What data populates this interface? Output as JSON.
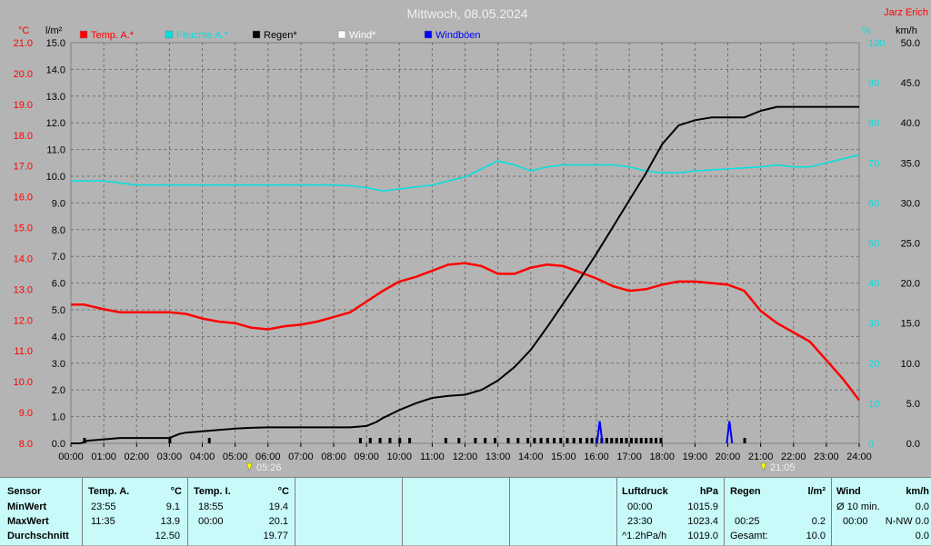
{
  "title": "Mittwoch, 08.05.2024",
  "author": "Jarz Erich",
  "axis_units": {
    "temp": "°C",
    "rain": "l/m²",
    "humidity": "%",
    "wind": "km/h"
  },
  "colors": {
    "temp": "#ff0000",
    "humidity": "#00e0e0",
    "rain": "#000000",
    "wind": "#ffffff",
    "gust": "#0000ff",
    "bg": "#b4b4b4",
    "grid": "#707070",
    "panel": "#c8fafa"
  },
  "legend": [
    {
      "label": "Temp. A.*",
      "color": "#ff0000"
    },
    {
      "label": "Feuchte A.*",
      "color": "#00e0e0"
    },
    {
      "label": "Regen*",
      "color": "#000000"
    },
    {
      "label": "Wind*",
      "color": "#ffffff"
    },
    {
      "label": "Windböen",
      "color": "#0000ff"
    }
  ],
  "sun": {
    "sunrise": "05:26",
    "sunset": "21:05"
  },
  "chart_data": {
    "type": "line",
    "x_ticks": [
      "00:00",
      "01:00",
      "02:00",
      "03:00",
      "04:00",
      "05:00",
      "06:00",
      "07:00",
      "08:00",
      "09:00",
      "10:00",
      "11:00",
      "12:00",
      "13:00",
      "14:00",
      "15:00",
      "16:00",
      "17:00",
      "18:00",
      "19:00",
      "20:00",
      "21:00",
      "22:00",
      "23:00",
      "24:00"
    ],
    "temp_ticks": [
      "21.0",
      "20.0",
      "19.0",
      "18.0",
      "17.0",
      "16.0",
      "15.0",
      "14.0",
      "13.0",
      "12.0",
      "11.0",
      "10.0",
      "9.0",
      "8.0"
    ],
    "rain_ticks": [
      "15.0",
      "14.0",
      "13.0",
      "12.0",
      "11.0",
      "10.0",
      "9.0",
      "8.0",
      "7.0",
      "6.0",
      "5.0",
      "4.0",
      "3.0",
      "2.0",
      "1.0",
      "0.0"
    ],
    "hum_ticks": [
      "100",
      "90",
      "80",
      "70",
      "60",
      "50",
      "40",
      "30",
      "20",
      "10",
      "0"
    ],
    "wind_ticks": [
      "50.0",
      "45.0",
      "40.0",
      "35.0",
      "30.0",
      "25.0",
      "20.0",
      "15.0",
      "10.0",
      "5.0",
      "0.0"
    ],
    "temp_range": [
      8,
      21
    ],
    "rain_range": [
      0,
      15
    ],
    "hum_range": [
      0,
      100
    ],
    "wind_range": [
      0,
      50
    ],
    "series": [
      {
        "name": "Temp. A.*",
        "axis": "temp",
        "x": [
          0,
          0.4,
          1,
          1.5,
          2,
          2.5,
          3,
          3.5,
          4,
          4.5,
          5,
          5.5,
          6,
          6.5,
          7,
          7.5,
          8,
          8.5,
          9,
          9.5,
          10,
          10.5,
          11,
          11.5,
          12,
          12.5,
          13,
          13.5,
          14,
          14.5,
          15,
          15.5,
          16,
          16.5,
          17,
          17.5,
          18,
          18.5,
          19,
          19.5,
          20,
          20.5,
          21,
          21.5,
          22,
          22.5,
          23,
          23.5,
          24
        ],
        "y": [
          12.5,
          12.5,
          12.35,
          12.25,
          12.25,
          12.25,
          12.25,
          12.2,
          12.05,
          11.95,
          11.9,
          11.75,
          11.7,
          11.8,
          11.85,
          11.95,
          12.1,
          12.25,
          12.6,
          12.95,
          13.25,
          13.4,
          13.6,
          13.8,
          13.85,
          13.75,
          13.5,
          13.5,
          13.7,
          13.8,
          13.75,
          13.55,
          13.35,
          13.1,
          12.95,
          13.0,
          13.15,
          13.25,
          13.25,
          13.2,
          13.15,
          12.95,
          12.3,
          11.9,
          11.6,
          11.3,
          10.7,
          10.1,
          9.4
        ]
      },
      {
        "name": "Feuchte A.*",
        "axis": "humidity",
        "x": [
          0,
          1,
          1.5,
          2,
          3,
          4,
          5,
          6,
          7,
          8,
          8.5,
          9,
          9.5,
          10,
          11,
          12,
          12.5,
          13,
          13.5,
          14,
          14.5,
          15,
          16,
          16.5,
          17,
          17.5,
          18,
          18.5,
          19,
          20,
          21,
          21.5,
          22,
          22.5,
          23,
          23.5,
          24
        ],
        "y": [
          65.5,
          65.5,
          65,
          64.5,
          64.5,
          64.5,
          64.5,
          64.5,
          64.5,
          64.5,
          64.3,
          63.8,
          63,
          63.5,
          64.5,
          66.5,
          68.5,
          70.5,
          69.5,
          68,
          69,
          69.5,
          69.5,
          69.5,
          69,
          68,
          67.5,
          67.5,
          68,
          68.5,
          69,
          69.5,
          69,
          69,
          70,
          71,
          72
        ]
      },
      {
        "name": "Regen*",
        "axis": "rain",
        "x": [
          0,
          0.3,
          0.5,
          1,
          1.5,
          2,
          2.5,
          3,
          3.3,
          3.5,
          4,
          4.5,
          5,
          5.5,
          6,
          6.5,
          7,
          7.5,
          8,
          8.5,
          9,
          9.3,
          9.5,
          10,
          10.5,
          11,
          11.5,
          12,
          12.5,
          13,
          13.5,
          14,
          14.5,
          15,
          15.5,
          16,
          16.5,
          17,
          17.5,
          18,
          18.5,
          19,
          19.5,
          20,
          20.5,
          21,
          21.5,
          22,
          23,
          24
        ],
        "y": [
          0,
          0,
          0.1,
          0.15,
          0.2,
          0.2,
          0.2,
          0.2,
          0.35,
          0.4,
          0.45,
          0.5,
          0.55,
          0.58,
          0.6,
          0.6,
          0.6,
          0.6,
          0.6,
          0.6,
          0.65,
          0.8,
          0.95,
          1.25,
          1.5,
          1.7,
          1.78,
          1.82,
          2.0,
          2.35,
          2.85,
          3.5,
          4.35,
          5.25,
          6.15,
          7.1,
          8.1,
          9.1,
          10.1,
          11.2,
          11.9,
          12.1,
          12.2,
          12.2,
          12.2,
          12.45,
          12.6,
          12.6,
          12.6,
          12.6
        ]
      },
      {
        "name": "Windböen",
        "axis": "wind",
        "x": [
          16.1,
          20.05
        ],
        "y": [
          1.4,
          1.4
        ]
      }
    ],
    "rain_ticks_at": [
      0.4,
      3.0,
      4.2,
      8.8,
      9.1,
      9.4,
      9.7,
      10.0,
      10.3,
      11.4,
      11.8,
      12.3,
      12.6,
      12.9,
      13.3,
      13.6,
      13.9,
      14.1,
      14.3,
      14.5,
      14.7,
      14.9,
      15.1,
      15.3,
      15.5,
      15.7,
      15.85,
      16.0,
      16.15,
      16.3,
      16.45,
      16.6,
      16.75,
      16.9,
      17.05,
      17.2,
      17.35,
      17.5,
      17.65,
      17.8,
      17.95,
      20.5
    ]
  },
  "panel": {
    "sensor": {
      "header": "Sensor",
      "rows": [
        "MinWert",
        "MaxWert",
        "Durchschnitt"
      ]
    },
    "temp_a": {
      "header": "Temp. A.",
      "unit": "°C",
      "times": [
        "23:55",
        "11:35",
        ""
      ],
      "values": [
        "9.1",
        "13.9",
        "12.50"
      ]
    },
    "temp_i": {
      "header": "Temp. I.",
      "unit": "°C",
      "times": [
        "18:55",
        "00:00",
        ""
      ],
      "values": [
        "19.4",
        "20.1",
        "19.77"
      ]
    },
    "pressure": {
      "header": "Luftdruck",
      "unit": "hPa",
      "times": [
        "00:00",
        "23:30",
        "^1.2hPa/h"
      ],
      "values": [
        "1015.9",
        "1023.4",
        "1019.0"
      ]
    },
    "rain": {
      "header": "Regen",
      "unit": "l/m²",
      "times": [
        "",
        "00:25",
        "Gesamt:"
      ],
      "values": [
        "",
        "0.2",
        "10.0"
      ]
    },
    "wind": {
      "header": "Wind",
      "unit": "km/h",
      "times": [
        "Ø 10 min.",
        "00:00",
        ""
      ],
      "values": [
        "0.0",
        "N-NW 0.0",
        "0.0"
      ]
    }
  }
}
